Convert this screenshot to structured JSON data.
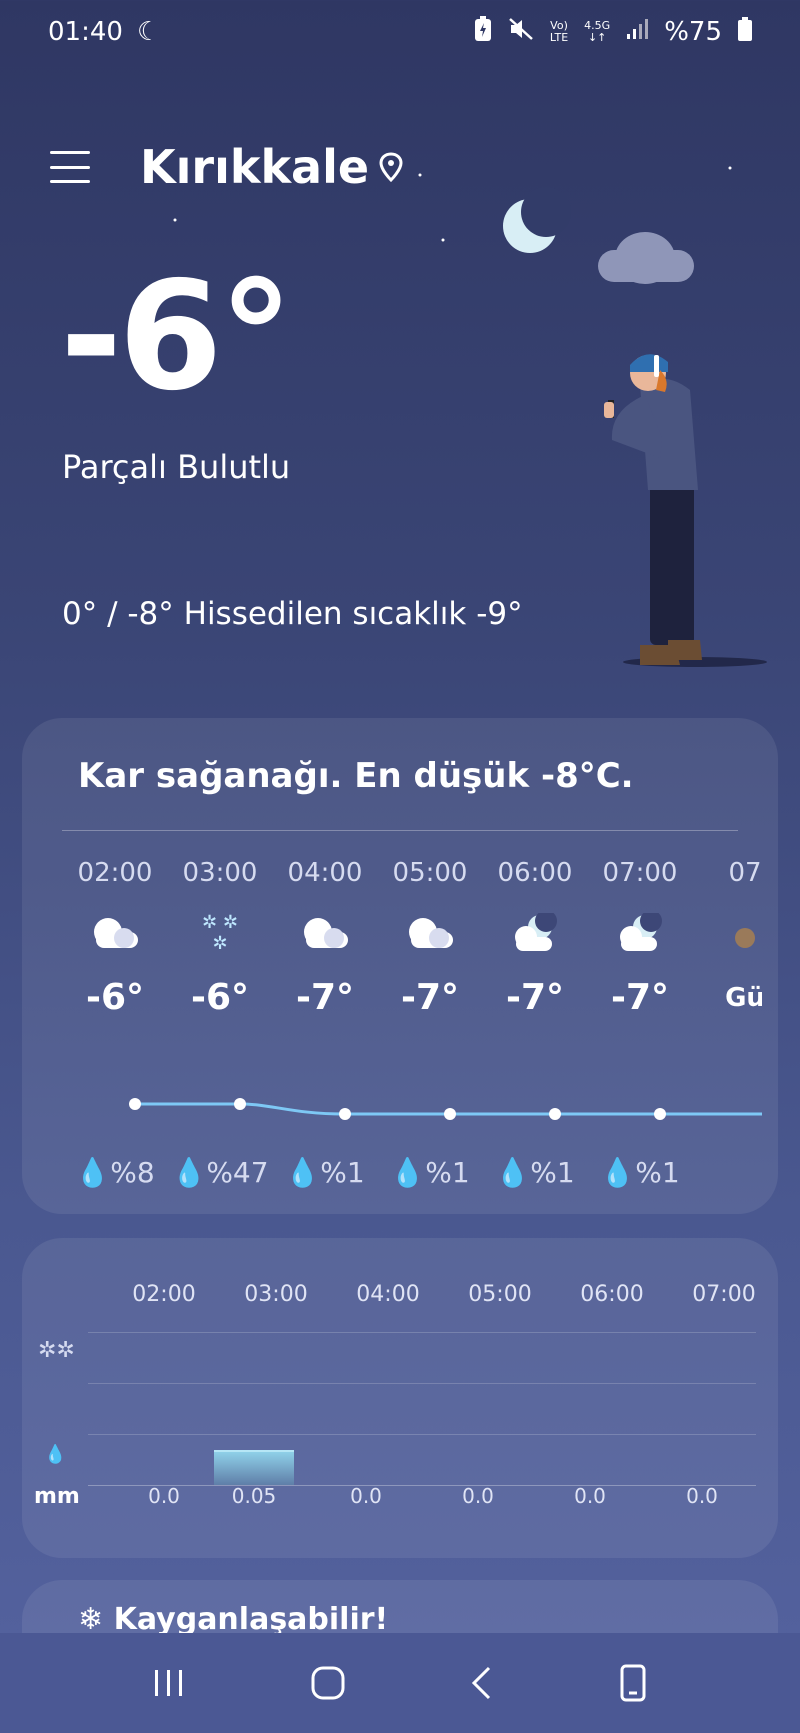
{
  "status_bar": {
    "time": "01:40",
    "network_top": "Vo)",
    "network_bottom": "LTE",
    "network_type": "4.5G",
    "battery": "%75"
  },
  "header": {
    "city": "Kırıkkale"
  },
  "current": {
    "temperature": "-6°",
    "condition": "Parçalı Bulutlu",
    "feels_line": "0° / -8° Hissedilen sıcaklık -9°"
  },
  "forecast_card": {
    "alert": "Kar sağanağı. En düşük -8°C.",
    "hours": [
      {
        "time": "02:00",
        "icon": "cloud-icon",
        "temp": "-6°",
        "rain": "%8"
      },
      {
        "time": "03:00",
        "icon": "snow-icon",
        "temp": "-6°",
        "rain": "%47"
      },
      {
        "time": "04:00",
        "icon": "cloud-icon",
        "temp": "-7°",
        "rain": "%1"
      },
      {
        "time": "05:00",
        "icon": "cloud-icon",
        "temp": "-7°",
        "rain": "%1"
      },
      {
        "time": "06:00",
        "icon": "moon-cloud-icon",
        "temp": "-7°",
        "rain": "%1"
      },
      {
        "time": "07:00",
        "icon": "moon-cloud-icon",
        "temp": "-7°",
        "rain": "%1"
      },
      {
        "time": "07",
        "icon": "sunrise-icon",
        "temp": "Gü",
        "rain": ""
      }
    ]
  },
  "precip_card": {
    "times": [
      "02:00",
      "03:00",
      "04:00",
      "05:00",
      "06:00",
      "07:00"
    ],
    "values": [
      "0.0",
      "0.05",
      "0.0",
      "0.0",
      "0.0",
      "0.0"
    ],
    "unit": "mm"
  },
  "next_card": {
    "text": "Kayganlaşabilir!"
  },
  "colors": {
    "bg_top": "#2f3763",
    "bg_bottom": "#5563a0",
    "line": "#7ec8f5"
  }
}
